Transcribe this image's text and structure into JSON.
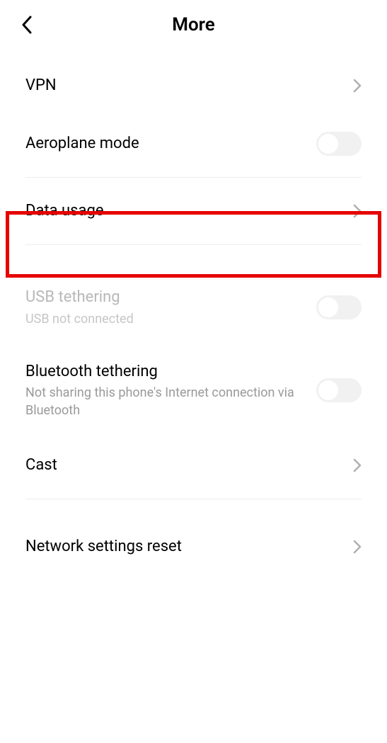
{
  "header": {
    "title": "More"
  },
  "items": {
    "vpn": {
      "label": "VPN"
    },
    "aeroplane": {
      "label": "Aeroplane mode"
    },
    "data_usage": {
      "label": "Data usage"
    },
    "usb_tethering": {
      "label": "USB tethering",
      "sub": "USB not connected"
    },
    "bt_tethering": {
      "label": "Bluetooth tethering",
      "sub": "Not sharing this phone's Internet connection via Bluetooth"
    },
    "cast": {
      "label": "Cast"
    },
    "network_reset": {
      "label": "Network settings reset"
    }
  }
}
